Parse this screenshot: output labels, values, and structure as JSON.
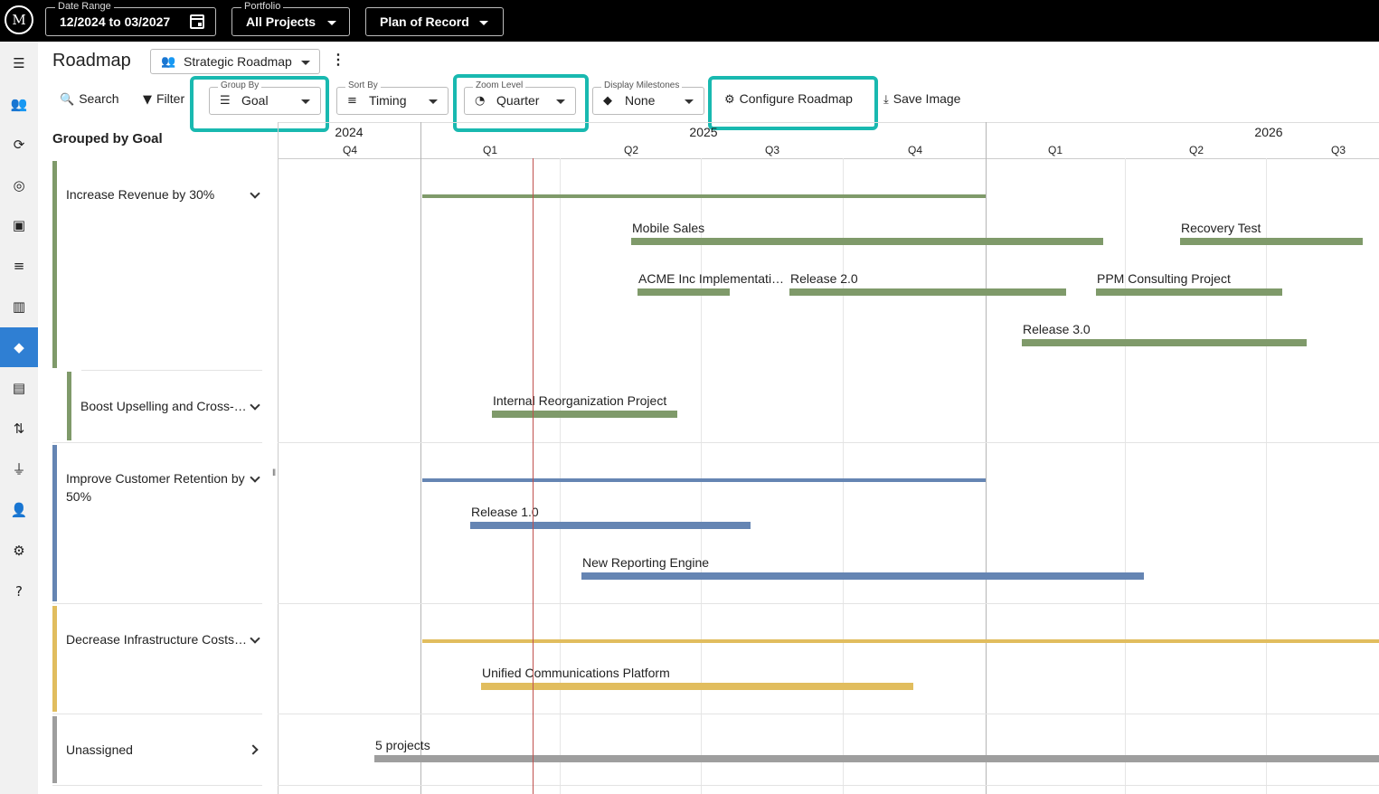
{
  "topbar": {
    "date_range": {
      "label": "Date Range",
      "value": "12/2024 to 03/2027"
    },
    "portfolio": {
      "label": "Portfolio",
      "value": "All Projects"
    },
    "plan": {
      "value": "Plan of Record"
    }
  },
  "header": {
    "title": "Roadmap",
    "view": "Strategic Roadmap"
  },
  "toolbar": {
    "search": "Search",
    "filter": "Filter",
    "group_by": {
      "label": "Group By",
      "value": "Goal"
    },
    "sort_by": {
      "label": "Sort By",
      "value": "Timing"
    },
    "zoom": {
      "label": "Zoom Level",
      "value": "Quarter"
    },
    "milestones": {
      "label": "Display Milestones",
      "value": "None"
    },
    "configure": "Configure Roadmap",
    "save_image": "Save Image"
  },
  "sidebar": {
    "title": "Grouped by Goal",
    "groups": [
      {
        "label": "Increase Revenue by 30%",
        "color": "#7f9a6a"
      },
      {
        "label": "Boost Upselling and Cross-…",
        "color": "#7f9a6a"
      },
      {
        "label": "Improve Customer Retention by 50%",
        "color": "#6585b3"
      },
      {
        "label": "Decrease Infrastructure Costs…",
        "color": "#e1bd5e"
      },
      {
        "label": "Unassigned",
        "color": "#9e9e9e"
      }
    ]
  },
  "timeline": {
    "years": [
      "2024",
      "2025",
      "2026"
    ],
    "quarters": [
      "Q4",
      "Q1",
      "Q2",
      "Q3",
      "Q4",
      "Q1",
      "Q2",
      "Q3"
    ],
    "projects": {
      "mobile_sales": "Mobile Sales",
      "recovery_test": "Recovery Test",
      "acme": "ACME Inc Implementati…",
      "release_2": "Release 2.0",
      "ppm": "PPM Consulting Project",
      "release_3": "Release 3.0",
      "internal_reorg": "Internal Reorganization Project",
      "release_1": "Release 1.0",
      "reporting": "New Reporting Engine",
      "unified": "Unified Communications Platform",
      "unassigned": "5 projects"
    }
  },
  "colors": {
    "green": "#7f9a6a",
    "blue": "#6585b3",
    "yellow": "#e1bd5e",
    "gray": "#9e9e9e",
    "accent": "#19b9b0",
    "nav_active": "#2f7fd3"
  }
}
